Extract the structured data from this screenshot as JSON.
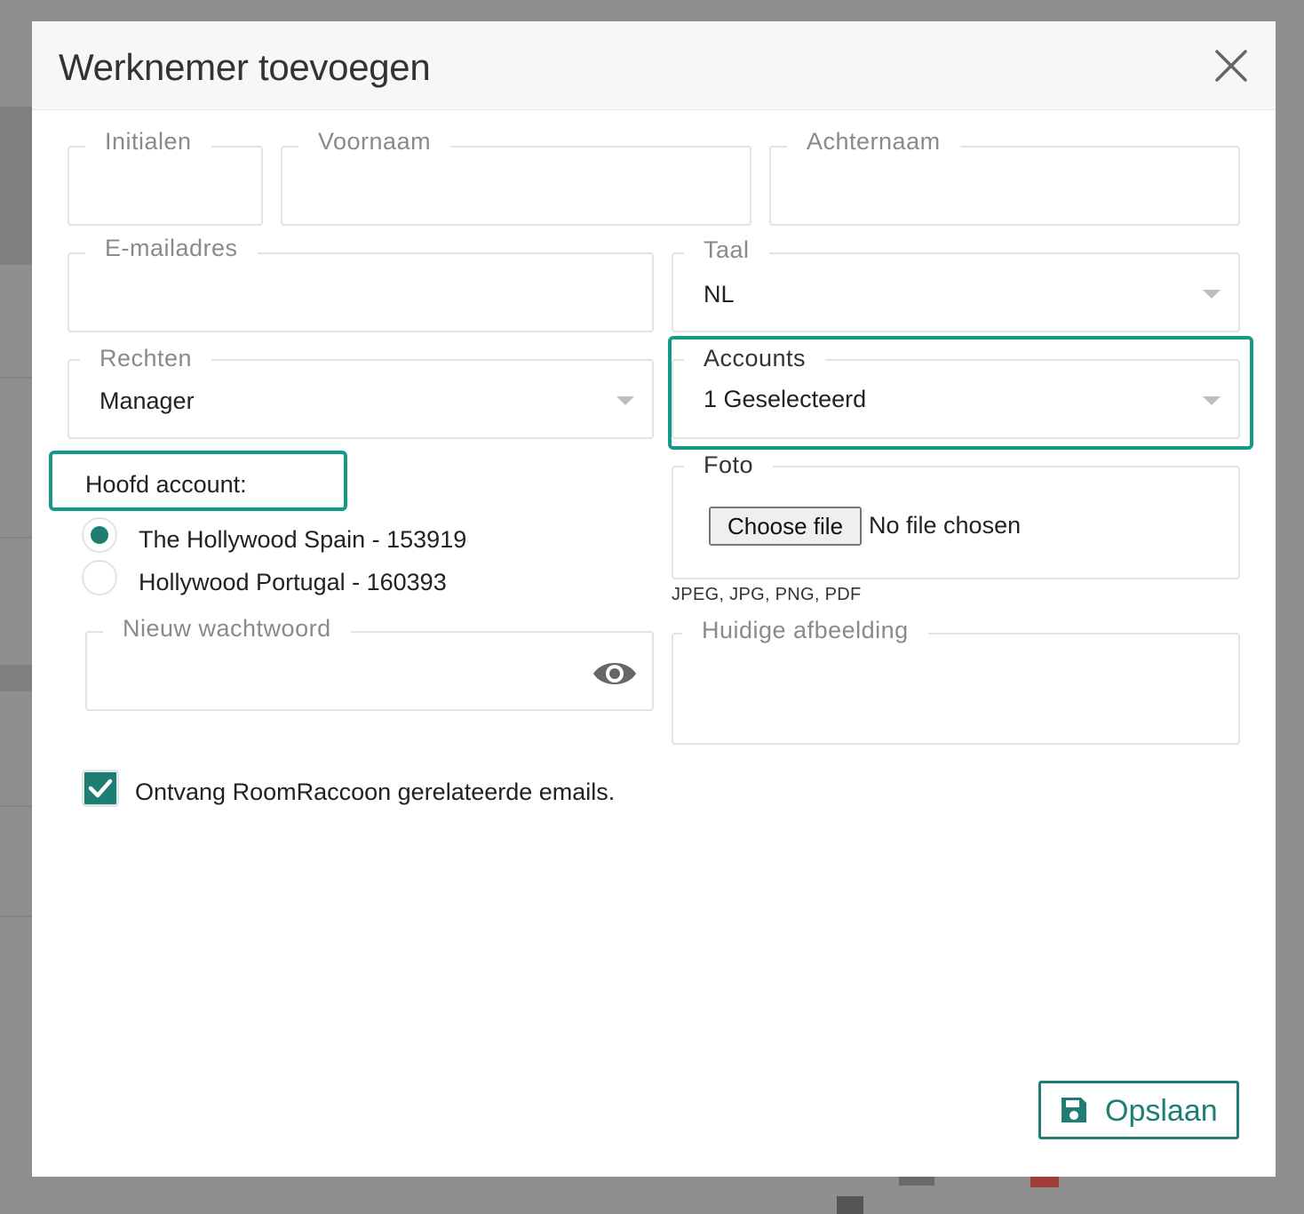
{
  "modal": {
    "title": "Werknemer toevoegen",
    "fields": {
      "initials": {
        "label": "Initialen",
        "value": ""
      },
      "first_name": {
        "label": "Voornaam",
        "value": ""
      },
      "last_name": {
        "label": "Achternaam",
        "value": ""
      },
      "email": {
        "label": "E-mailadres",
        "value": ""
      },
      "language": {
        "label": "Taal",
        "value": "NL"
      },
      "rights": {
        "label": "Rechten",
        "value": "Manager"
      },
      "accounts": {
        "label": "Accounts",
        "value": "1 Geselecteerd"
      },
      "photo": {
        "label": "Foto",
        "button": "Choose file",
        "status": "No file chosen",
        "hint": "JPEG, JPG, PNG, PDF"
      },
      "new_password": {
        "label": "Nieuw wachtwoord",
        "value": ""
      },
      "current_image": {
        "label": "Huidige afbeelding"
      }
    },
    "main_account": {
      "label": "Hoofd account:",
      "options": [
        {
          "label": "The Hollywood Spain - 153919",
          "checked": true
        },
        {
          "label": "Hollywood Portugal - 160393",
          "checked": false
        }
      ]
    },
    "emails_checkbox": {
      "label": "Ontvang RoomRaccoon gerelateerde emails.",
      "checked": true
    },
    "save_label": "Opslaan"
  },
  "colors": {
    "accent": "#1e7e74",
    "highlight": "#159a8a",
    "overlay": "#8f8f8f"
  },
  "icons": [
    "close-icon",
    "chevron-down-icon",
    "eye-icon",
    "check-icon",
    "floppy-disk-icon"
  ]
}
